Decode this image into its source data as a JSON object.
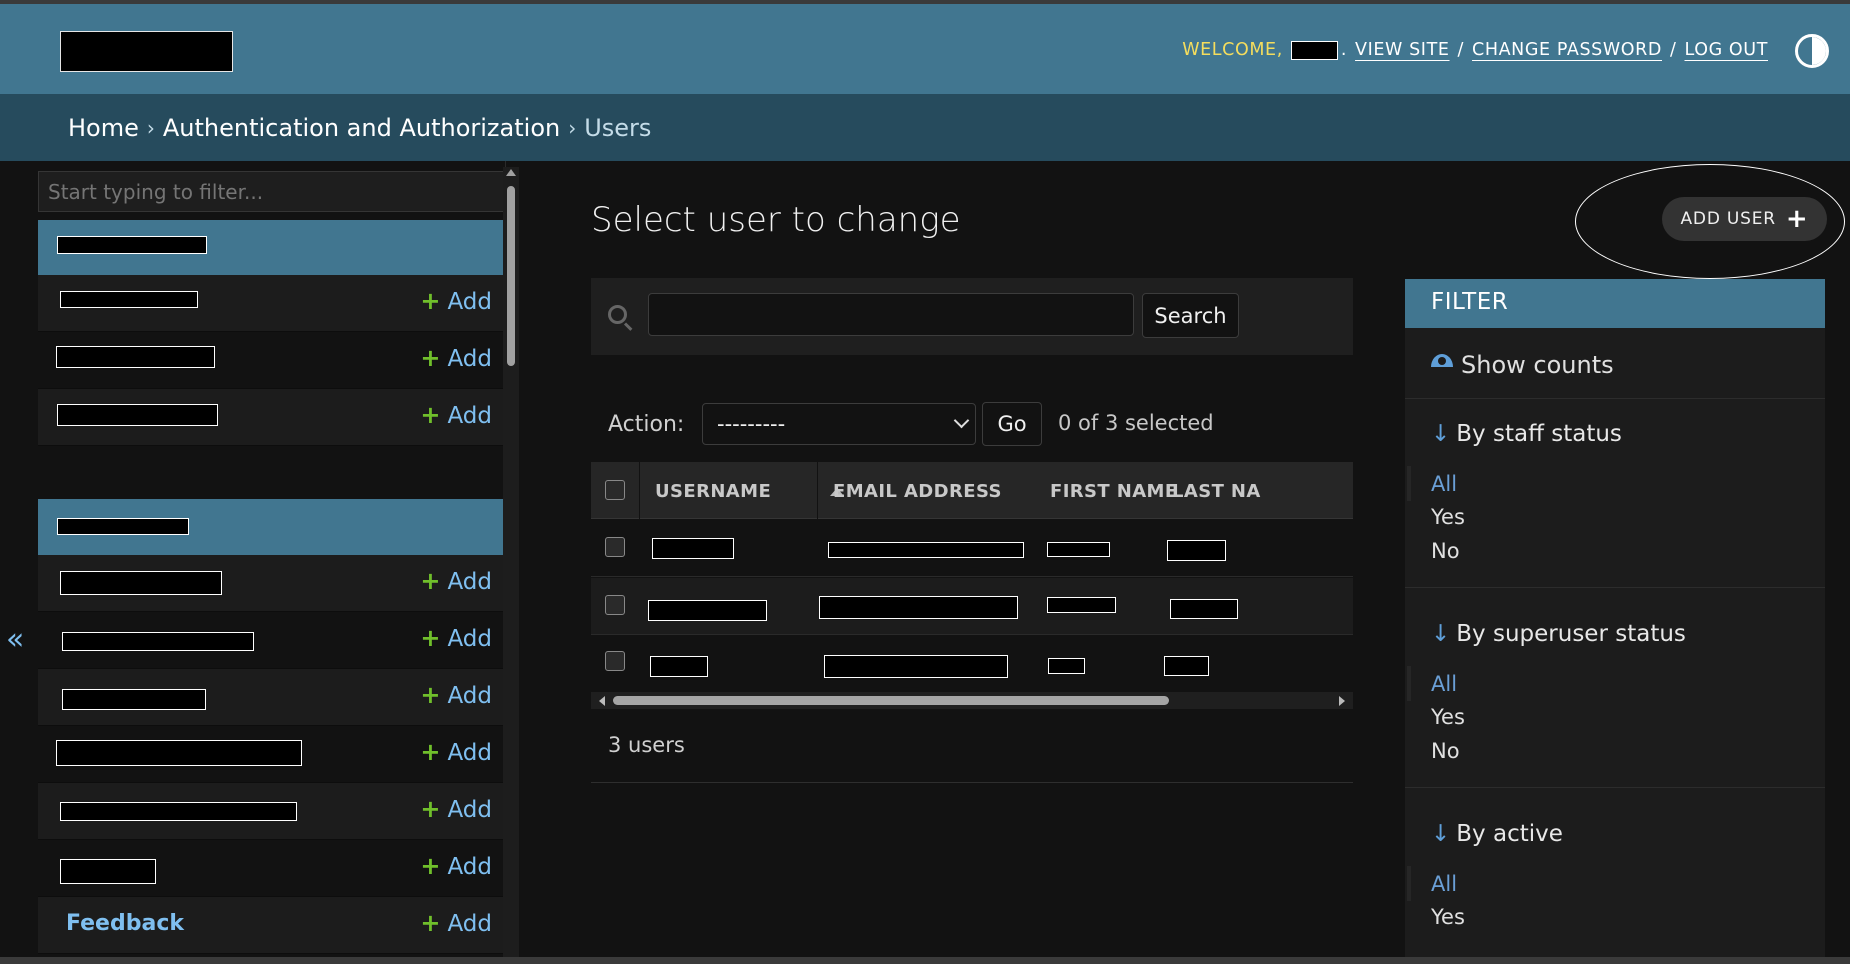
{
  "header": {
    "welcome_label": "WELCOME,",
    "view_site": "VIEW SITE",
    "change_password": "CHANGE PASSWORD",
    "log_out": "LOG OUT",
    "sep": "/",
    "dot": "."
  },
  "breadcrumbs": {
    "home": "Home",
    "app": "Authentication and Authorization",
    "current": "Users",
    "sep": "›"
  },
  "sidebar": {
    "filter_placeholder": "Start typing to filter...",
    "add_label": "Add",
    "add_plus": "+",
    "feedback_label": "Feedback",
    "collapse_glyph": "«"
  },
  "content": {
    "title": "Select user to change",
    "add_user": "ADD USER",
    "add_plus": "+"
  },
  "search": {
    "button": "Search"
  },
  "actions": {
    "label": "Action:",
    "selected_option": "---------",
    "go": "Go",
    "counter": "0 of 3 selected"
  },
  "table": {
    "columns": [
      "USERNAME",
      "EMAIL ADDRESS",
      "FIRST NAME",
      "LAST NA"
    ]
  },
  "paginator": {
    "count": "3 users"
  },
  "filter": {
    "title": "FILTER",
    "show_counts": "Show counts",
    "arrow": "↓",
    "groups": [
      {
        "title": "By staff status",
        "options": [
          "All",
          "Yes",
          "No"
        ]
      },
      {
        "title": "By superuser status",
        "options": [
          "All",
          "Yes",
          "No"
        ]
      },
      {
        "title": "By active",
        "options": [
          "All",
          "Yes"
        ]
      }
    ]
  },
  "colors": {
    "header": "#417690",
    "breadcrumbs": "#264b5d",
    "link": "#7fbff0",
    "add_plus": "#70bf2b",
    "background": "#121212"
  },
  "icons": {
    "search": "search-icon",
    "theme": "theme-toggle-icon",
    "eye": "eye-icon",
    "sort": "sort-ascending-icon",
    "collapse": "double-chevron-left-icon"
  }
}
